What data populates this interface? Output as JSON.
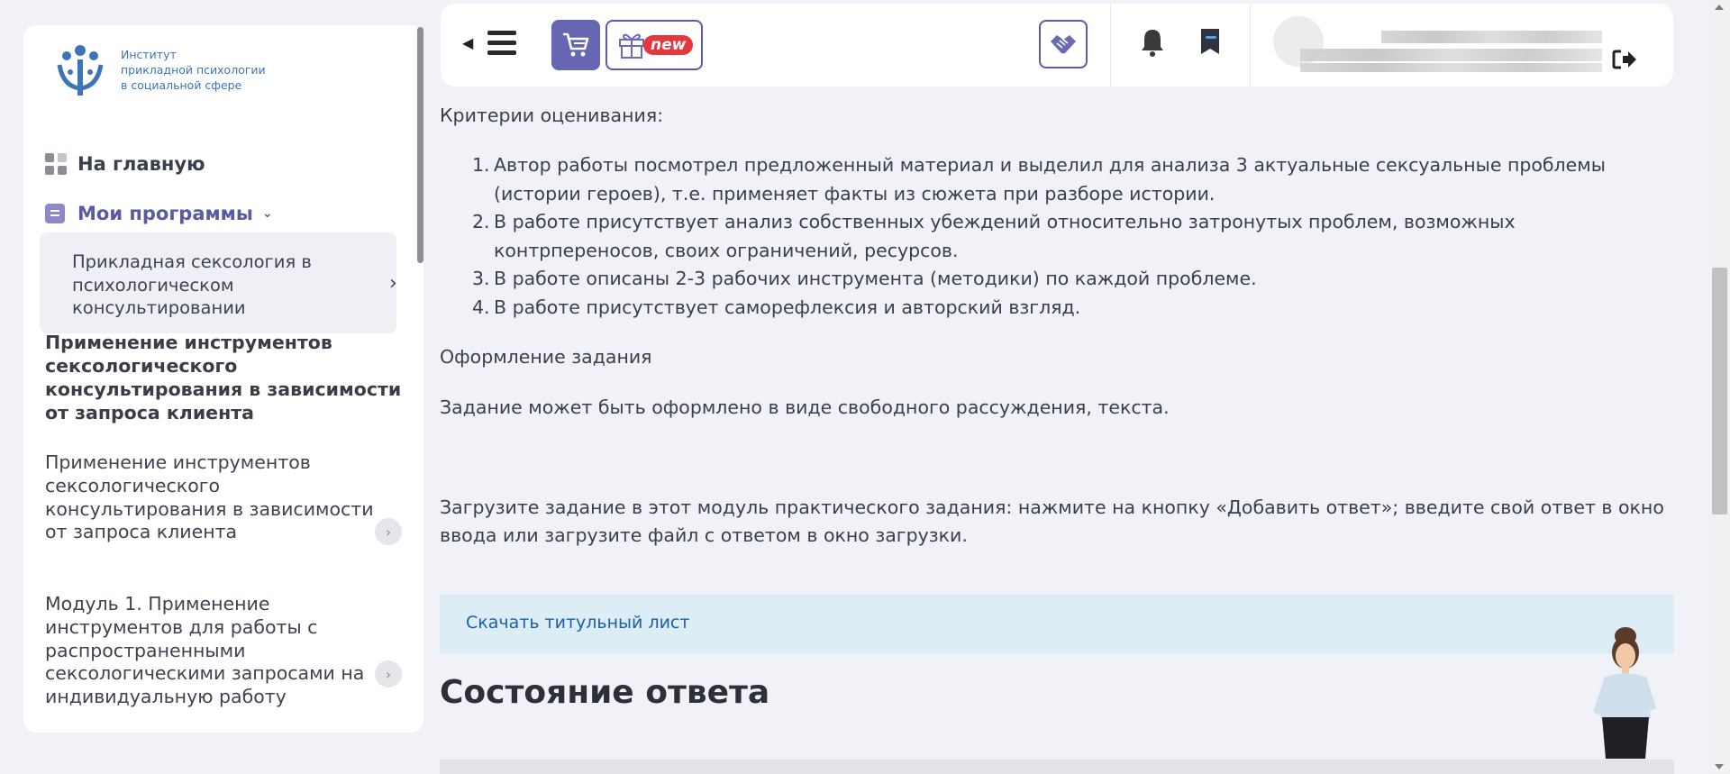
{
  "sidebar": {
    "logo_lines": [
      "Институт",
      "прикладной психологии",
      "в социальной сфере"
    ],
    "home_label": "На главную",
    "programs_label": "Мои программы",
    "current_program": "Прикладная сексология в психологическом консультировании",
    "section_title": "Применение инструментов сексологического консультирования в зависимости от запроса клиента",
    "items": [
      {
        "label": "Применение инструментов сексологического консультирования в зависимости от запроса клиента"
      },
      {
        "label": "Модуль 1. Применение инструментов для работы с распространенными сексологическими запросами на индивидуальную работу"
      }
    ]
  },
  "header": {
    "new_badge": "new",
    "icons": [
      "back-arrow-icon",
      "menu-icon",
      "cart-icon",
      "gift-icon",
      "handshake-icon",
      "bell-icon",
      "bookmark-icon",
      "logout-icon"
    ]
  },
  "content": {
    "criteria_title": "Критерии оценивания:",
    "criteria": [
      {
        "num": "1.",
        "text": "Автор работы посмотрел предложенный материал и выделил для анализа 3 актуальные сексуальные проблемы (истории героев), т.е. применяет факты из сюжета при разборе истории."
      },
      {
        "num": "2.",
        "text": "В работе присутствует анализ собственных убеждений относительно затронутых проблем, возможных контрпереносов, своих ограничений, ресурсов."
      },
      {
        "num": "3.",
        "text": "В работе описаны 2-3 рабочих инструмента (методики) по каждой проблеме."
      },
      {
        "num": "4.",
        "text": "В работе присутствует саморефлексия и авторский взгляд."
      }
    ],
    "format_title": "Оформление задания",
    "format_text": "Задание может быть оформлено в виде свободного рассуждения, текста.",
    "upload_text": "Загрузите задание в этот модуль практического задания: нажмите на кнопку «Добавить ответ»; введите свой ответ в окно ввода или загрузите файл с ответом в окно загрузки.",
    "download_link": "Скачать титульный лист",
    "status_heading": "Состояние ответа"
  },
  "colors": {
    "accent": "#6666b3",
    "badge_red": "#e6373f",
    "link": "#1d5fa6",
    "info_bg": "#dcedf5",
    "page_bg": "#f1f2f7"
  }
}
